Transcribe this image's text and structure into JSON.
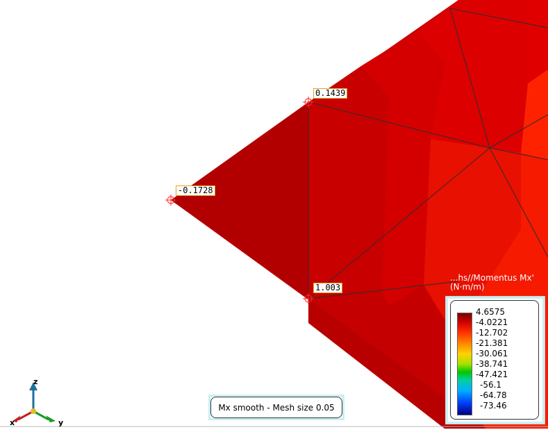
{
  "viewport": {
    "probes": [
      {
        "name": "probe-top",
        "value": "0.1439"
      },
      {
        "name": "probe-left",
        "value": "-0.1728"
      },
      {
        "name": "probe-bottom",
        "value": "1.003"
      }
    ]
  },
  "legend": {
    "title_line1": "...hs//Momentus Mx'",
    "title_line2": "(N·m/m)",
    "values": [
      "4.6575",
      "-4.0221",
      "-12.702",
      "-21.381",
      "-30.061",
      "-38.741",
      "-47.421",
      "-56.1",
      "-64.78",
      "-73.46"
    ]
  },
  "status": {
    "label": "Mx smooth - Mesh size 0.05"
  },
  "triad": {
    "x": "x",
    "y": "y",
    "z": "z"
  },
  "colors": {
    "dark_red": "#b00000",
    "red": "#d00000",
    "bright_red": "#ff1a00",
    "accent_cyan": "#c8f0f4"
  }
}
